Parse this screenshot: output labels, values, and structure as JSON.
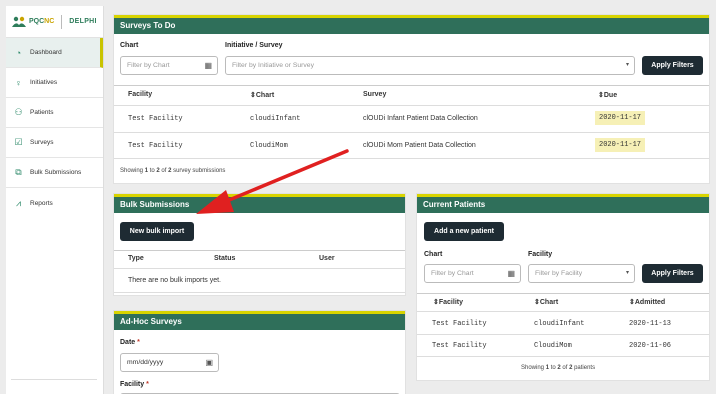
{
  "brand": {
    "part1": "PQC",
    "part2": "NC",
    "app": "DELPHI"
  },
  "nav": [
    {
      "label": "Dashboard",
      "icon": "gauge-icon"
    },
    {
      "label": "Initiatives",
      "icon": "lightbulb-icon"
    },
    {
      "label": "Patients",
      "icon": "people-icon"
    },
    {
      "label": "Surveys",
      "icon": "checkbox-icon"
    },
    {
      "label": "Bulk Submissions",
      "icon": "stack-icon"
    },
    {
      "label": "Reports",
      "icon": "chart-icon"
    }
  ],
  "surveys": {
    "title": "Surveys To Do",
    "chart_label": "Chart",
    "chart_placeholder": "Filter by Chart",
    "initiative_label": "Initiative / Survey",
    "initiative_placeholder": "Filter by Initiative or Survey",
    "apply_label": "Apply Filters",
    "columns": [
      "Facility",
      "Chart",
      "Survey",
      "Due"
    ],
    "rows": [
      {
        "facility": "Test Facility",
        "chart": "cloudiInfant",
        "survey": "clOUDi Infant Patient Data Collection",
        "due": "2020-11-17"
      },
      {
        "facility": "Test Facility",
        "chart": "CloudiMom",
        "survey": "clOUDi Mom Patient Data Collection",
        "due": "2020-11-17"
      }
    ],
    "showing": {
      "prefix": "Showing ",
      "from": "1",
      "to_word": " to ",
      "to": "2",
      "of_word": " of ",
      "total": "2",
      "suffix": " survey submissions"
    }
  },
  "bulk": {
    "title": "Bulk Submissions",
    "button": "New bulk import",
    "columns": [
      "Type",
      "Status",
      "User"
    ],
    "empty": "There are no bulk imports yet."
  },
  "adhoc": {
    "title": "Ad-Hoc Surveys",
    "date_label": "Date",
    "date_placeholder": "mm/dd/yyyy",
    "facility_label": "Facility",
    "required": "*"
  },
  "patients": {
    "title": "Current Patients",
    "add_button": "Add a new patient",
    "chart_label": "Chart",
    "chart_placeholder": "Filter by Chart",
    "facility_label": "Facility",
    "facility_placeholder": "Filter by Facility",
    "apply_label": "Apply Filters",
    "columns": [
      "Facility",
      "Chart",
      "Admitted"
    ],
    "rows": [
      {
        "facility": "Test Facility",
        "chart": "cloudiInfant",
        "admitted": "2020-11-13"
      },
      {
        "facility": "Test Facility",
        "chart": "CloudiMom",
        "admitted": "2020-11-06"
      }
    ],
    "showing": {
      "prefix": "Showing ",
      "from": "1",
      "to_word": " to ",
      "to": "2",
      "of_word": " of ",
      "total": "2",
      "suffix": " patients"
    }
  },
  "colors": {
    "header": "#2f6f5a",
    "accent": "#d8d400",
    "button": "#1e2b33",
    "due_highlight": "#f6f0b6",
    "annotation_arrow": "#e02020"
  }
}
